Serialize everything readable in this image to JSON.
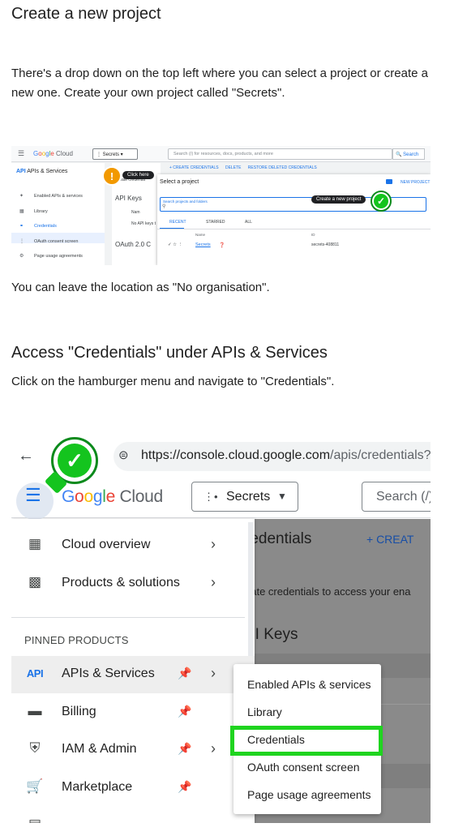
{
  "section1": {
    "heading": "Create a new project",
    "para1": "There's a drop down on the top left where you can select a project or create a new one. Create your own project called \"Secrets\".",
    "para2": "You can leave the location as \"No organisation\"."
  },
  "shot1": {
    "logo": "Google Cloud",
    "project": "Secrets",
    "search_placeholder": "Search (/) for resources, docs, products, and more",
    "search_button": "Search",
    "sidebar_title": "APIs & Services",
    "sidebar_items": [
      "Enabled APIs & services",
      "Library",
      "Credentials",
      "OAuth consent screen",
      "Page usage agreements"
    ],
    "callout_click": "Click here",
    "toolbar": [
      "+ CREATE CREDENTIALS",
      "DELETE",
      "RESTORE DELETED CREDENTIALS"
    ],
    "mid_text": [
      "Create credentia",
      "API Keys",
      "Nam",
      "No API keys t",
      "OAuth 2.0 C"
    ],
    "dialog_title": "Select a project",
    "new_project": "NEW PROJECT",
    "dialog_search_label": "Search projects and folders",
    "callout_new": "Create a new project",
    "tabs": [
      "RECENT",
      "STARRED",
      "ALL"
    ],
    "col_name": "Name",
    "col_id": "ID",
    "row_name": "Secrets",
    "row_id": "secrets-408811"
  },
  "section2": {
    "heading": "Access \"Credentials\" under APIs & Services",
    "para": "Click on the hamburger menu and navigate to \"Credentials\"."
  },
  "shot2": {
    "url_host": "https://console.cloud.google.com",
    "url_path": "/apis/credentials?",
    "logo_google": "Google",
    "logo_cloud": " Cloud",
    "project": "Secrets",
    "search_placeholder": "Search (/)",
    "bg_title": "redentials",
    "bg_create": "+ CREAT",
    "bg_desc": "eate credentials to access your ena",
    "bg_apikeys": "PI Keys",
    "nav_top": [
      {
        "label": "Cloud overview",
        "icon": "dashboard-icon"
      },
      {
        "label": "Products & solutions",
        "icon": "grid-icon"
      }
    ],
    "pinned_title": "PINNED PRODUCTS",
    "nav_pinned": [
      {
        "label": "APIs & Services",
        "icon": "api-icon"
      },
      {
        "label": "Billing",
        "icon": "billing-icon"
      },
      {
        "label": "IAM & Admin",
        "icon": "shield-icon"
      },
      {
        "label": "Marketplace",
        "icon": "cart-icon"
      }
    ],
    "submenu": [
      "Enabled APIs & services",
      "Library",
      "Credentials",
      "OAuth consent screen",
      "Page usage agreements"
    ],
    "highlight_color": "#1fd41f"
  }
}
